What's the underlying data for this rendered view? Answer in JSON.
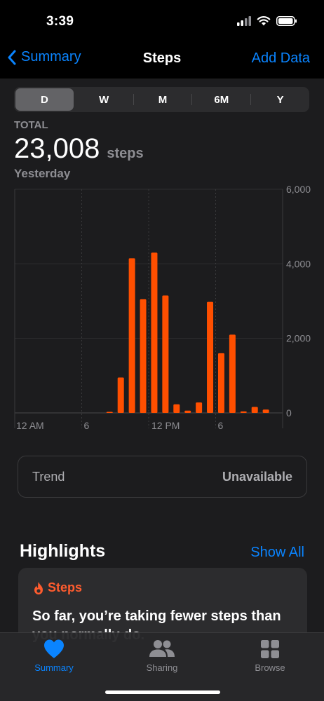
{
  "status_bar": {
    "time": "3:39"
  },
  "nav": {
    "back_label": "Summary",
    "title": "Steps",
    "action_label": "Add Data"
  },
  "range_tabs": [
    {
      "label": "D",
      "selected": true
    },
    {
      "label": "W",
      "selected": false
    },
    {
      "label": "M",
      "selected": false
    },
    {
      "label": "6M",
      "selected": false
    },
    {
      "label": "Y",
      "selected": false
    }
  ],
  "summary": {
    "total_label": "TOTAL",
    "total_value": "23,008",
    "unit": "steps",
    "period": "Yesterday"
  },
  "chart_data": {
    "type": "bar",
    "x_tick_labels": [
      "12 AM",
      "6",
      "12 PM",
      "6"
    ],
    "y_tick_labels": [
      "6,000",
      "4,000",
      "2,000",
      "0"
    ],
    "ylim": [
      0,
      6000
    ],
    "hours": [
      0,
      1,
      2,
      3,
      4,
      5,
      6,
      7,
      8,
      9,
      10,
      11,
      12,
      13,
      14,
      15,
      16,
      17,
      18,
      19,
      20,
      21,
      22,
      23
    ],
    "values": [
      0,
      0,
      0,
      0,
      0,
      0,
      0,
      0,
      20,
      950,
      4150,
      3050,
      4300,
      3150,
      230,
      60,
      280,
      2980,
      1600,
      2100,
      40,
      160,
      90,
      0
    ],
    "bar_color": "#ff4f00",
    "grid": true
  },
  "trend": {
    "label": "Trend",
    "value": "Unavailable"
  },
  "highlights": {
    "title": "Highlights",
    "show_all": "Show All",
    "card": {
      "category": "Steps",
      "text": "So far, you’re taking fewer steps than you normally do."
    }
  },
  "tab_bar": [
    {
      "label": "Summary",
      "icon": "heart-icon",
      "active": true
    },
    {
      "label": "Sharing",
      "icon": "people-icon",
      "active": false
    },
    {
      "label": "Browse",
      "icon": "grid-icon",
      "active": false
    }
  ],
  "colors": {
    "accent": "#0a84ff",
    "steps_orange": "#ff4f00"
  }
}
